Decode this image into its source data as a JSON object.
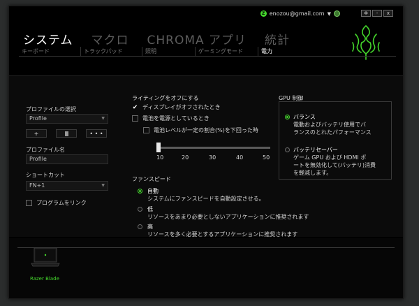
{
  "account": {
    "email": "enozou@gmail.com",
    "status_glyph": "Z",
    "caret": "▼"
  },
  "window_controls": [
    {
      "name": "settings",
      "glyph": "✲"
    },
    {
      "name": "minimize",
      "glyph": "-"
    },
    {
      "name": "close",
      "glyph": "x"
    }
  ],
  "main_tabs": [
    {
      "label": "システム",
      "active": true
    },
    {
      "label": "マクロ",
      "active": false
    },
    {
      "label": "CHROMA アプリ",
      "active": false
    },
    {
      "label": "統計",
      "active": false
    }
  ],
  "sub_tabs": [
    {
      "label": "キーボード",
      "active": false
    },
    {
      "label": "トラックパッド",
      "active": false
    },
    {
      "label": "照明",
      "active": false
    },
    {
      "label": "ゲーミングモード",
      "active": false
    },
    {
      "label": "電力",
      "active": true
    }
  ],
  "profile": {
    "select_label": "プロファイルの選択",
    "selected": "Profile",
    "buttons": [
      "+",
      "",
      "• • •"
    ],
    "name_label": "プロファイル名",
    "name_value": "Profile",
    "shortcut_label": "ショートカット",
    "shortcut_value": "FN+1",
    "link_label": "プログラムをリンク"
  },
  "lighting": {
    "heading": "ライティングをオフにする",
    "options": [
      {
        "label": "ディスプレイがオフされたとき",
        "checked": true
      },
      {
        "label": "電池を電源としているとき",
        "checked": false
      },
      {
        "label": "電池レベルが一定の割合(%)を下回った時",
        "checked": false
      }
    ],
    "slider": {
      "value": 10,
      "ticks": [
        "10",
        "20",
        "30",
        "40",
        "50"
      ]
    }
  },
  "fan": {
    "heading": "ファンスピード",
    "options": [
      {
        "title": "自動",
        "desc": "システムにファンスピードを自動設定させる。",
        "selected": true
      },
      {
        "title": "低",
        "desc": "リソースをあまり必要としないアプリケーションに推奨されます",
        "selected": false
      },
      {
        "title": "高",
        "desc": "リソースを多く必要とするアプリケーションに推奨されます",
        "selected": false
      }
    ]
  },
  "gpu": {
    "heading": "GPU 制御",
    "options": [
      {
        "title": "バランス",
        "desc": [
          "電動およびバッテリ使用でバ",
          "ランスのとれたパフォーマンス"
        ],
        "selected": true
      },
      {
        "title": "バッテリセーバー",
        "desc": [
          "ゲーム GPU および HDMI ポ",
          "ートを無効化して(バッテリ)消費",
          "を軽減します。"
        ],
        "selected": false
      }
    ]
  },
  "device": {
    "name": "Razer Blade"
  },
  "colors": {
    "accent": "#44d62c",
    "background": "#000000",
    "inactive_tab": "#5c5c5c"
  }
}
